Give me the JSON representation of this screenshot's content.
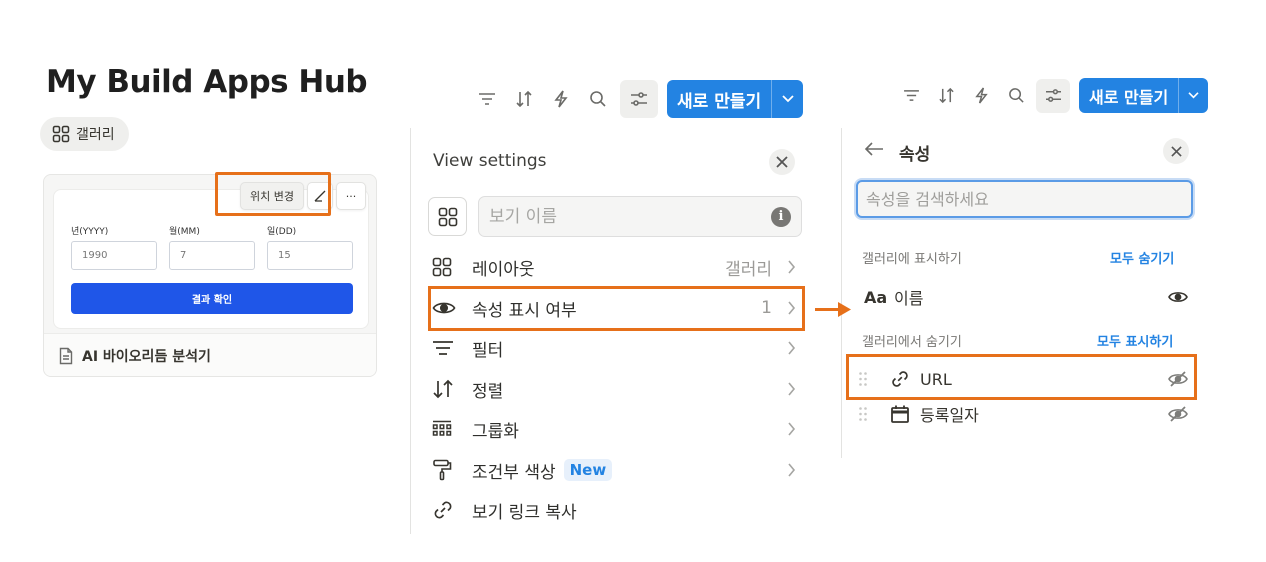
{
  "panel1": {
    "page_title": "My Build Apps Hub",
    "view_tab": {
      "label": "갤러리",
      "icon": "gallery-grid-icon"
    },
    "card": {
      "form": {
        "fields": [
          {
            "label": "년(YYYY)",
            "value": "1990"
          },
          {
            "label": "월(MM)",
            "value": "7"
          },
          {
            "label": "일(DD)",
            "value": "15"
          }
        ],
        "submit_label": "결과 확인"
      },
      "actions": {
        "move_label": "위치 변경",
        "edit_icon": "pencil-icon",
        "more_label": "···"
      },
      "title": "AI 바이오리듬 분석기",
      "title_icon": "page-icon"
    }
  },
  "toolbar": {
    "icons": [
      "filter-icon",
      "sort-icon",
      "lightning-icon",
      "search-icon",
      "settings-sliders-icon"
    ],
    "new_label": "새로 만들기"
  },
  "view_settings": {
    "title": "View settings",
    "name_placeholder": "보기 이름",
    "items": [
      {
        "label": "레이아웃",
        "value": "갤러리",
        "icon": "gallery-grid-icon"
      },
      {
        "label": "속성 표시 여부",
        "value": "1",
        "icon": "eye-icon"
      },
      {
        "label": "필터",
        "value": "",
        "icon": "filter-icon"
      },
      {
        "label": "정렬",
        "value": "",
        "icon": "sort-icon"
      },
      {
        "label": "그룹화",
        "value": "",
        "icon": "group-icon"
      },
      {
        "label": "조건부 색상",
        "value": "",
        "badge": "New",
        "icon": "paint-roller-icon"
      },
      {
        "label": "보기 링크 복사",
        "value": "",
        "icon": "link-icon"
      }
    ]
  },
  "properties": {
    "title": "속성",
    "search_placeholder": "속성을 검색하세요",
    "shown_section": {
      "label": "갤러리에 표시하기",
      "action": "모두 숨기기"
    },
    "shown": [
      {
        "name": "이름",
        "type_icon": "Aa"
      }
    ],
    "hidden_section": {
      "label": "갤러리에서 숨기기",
      "action": "모두 표시하기"
    },
    "hidden": [
      {
        "name": "URL",
        "type_icon": "link-icon"
      },
      {
        "name": "등록일자",
        "type_icon": "calendar-icon"
      }
    ]
  },
  "colors": {
    "accent": "#2383e2",
    "highlight": "#e6701a",
    "form_button": "#1f56e8"
  }
}
